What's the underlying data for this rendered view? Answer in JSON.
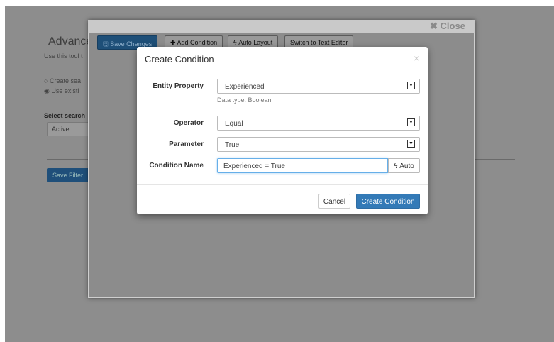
{
  "background_page": {
    "title": "Advance",
    "subtitle": "Use this tool t",
    "radio_options": [
      {
        "label": "Create sea",
        "selected": false
      },
      {
        "label": "Use existi",
        "selected": true
      }
    ],
    "select_label": "Select search",
    "select_value": "Active",
    "save_filter_label": "Save Filter"
  },
  "editor": {
    "close_label": "✖ Close",
    "toolbar": {
      "save_changes": "🖫 Save Changes",
      "add_condition": "✚ Add Condition",
      "auto_layout": "ϟ Auto Layout",
      "switch_text": "Switch to Text Editor"
    }
  },
  "modal": {
    "title": "Create Condition",
    "close_glyph": "×",
    "fields": {
      "entity_property": {
        "label": "Entity Property",
        "value": "Experienced",
        "help": "Data type: Boolean"
      },
      "operator": {
        "label": "Operator",
        "value": "Equal"
      },
      "parameter": {
        "label": "Parameter",
        "value": "True"
      },
      "condition_name": {
        "label": "Condition Name",
        "value": "Experienced = True",
        "auto_label": "ϟ Auto"
      }
    },
    "buttons": {
      "cancel": "Cancel",
      "create": "Create Condition"
    }
  },
  "colors": {
    "primary": "#337ab7",
    "overlay": "#8d8d8d"
  }
}
